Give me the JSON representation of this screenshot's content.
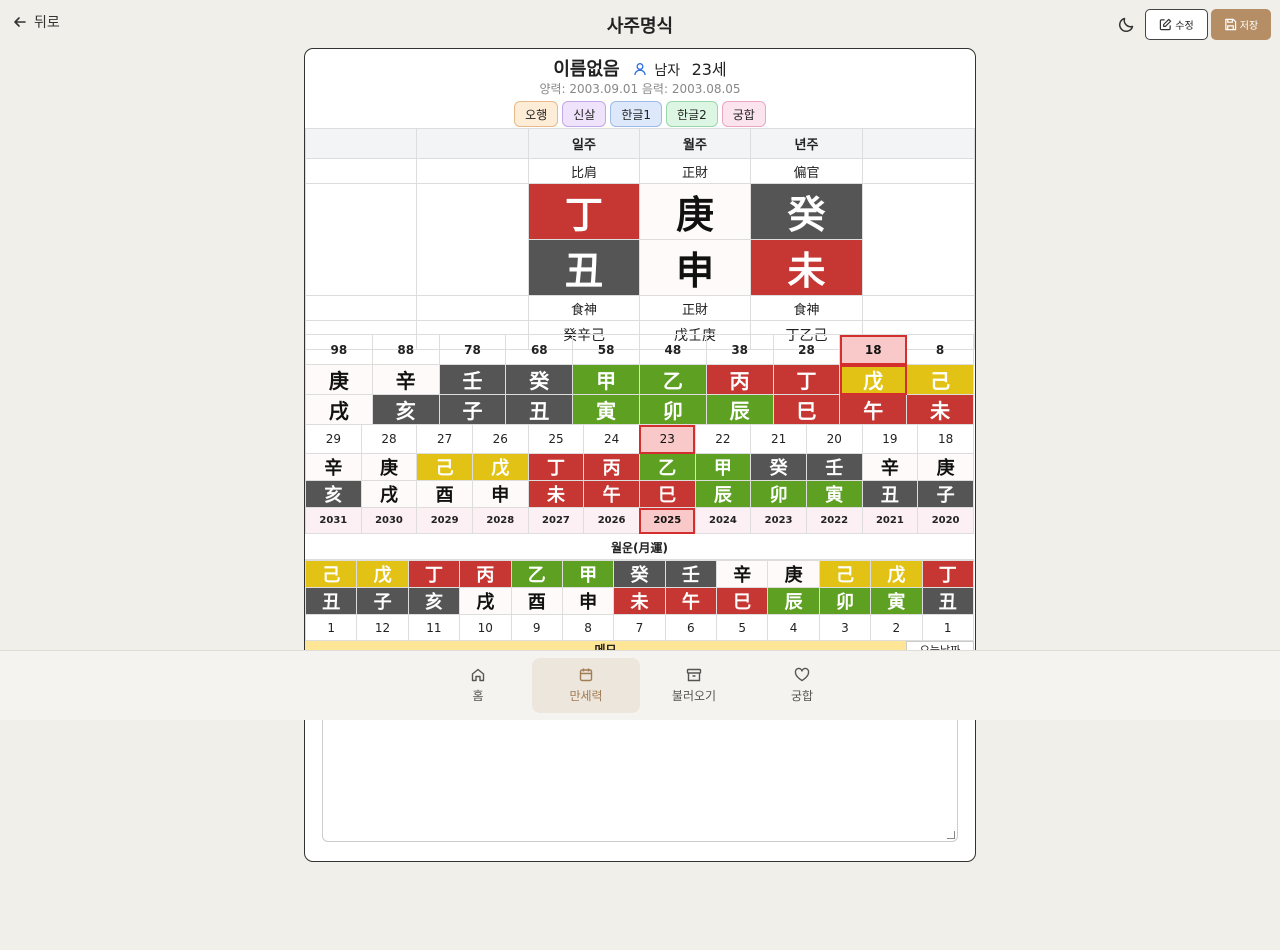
{
  "header": {
    "back_label": "뒤로",
    "title": "사주명식",
    "edit_label": "수정",
    "save_label": "저장"
  },
  "profile": {
    "name": "이름없음",
    "gender": "남자",
    "age": "23세",
    "dates": "양력: 2003.09.01 음력: 2003.08.05"
  },
  "tabs": [
    {
      "label": "오행",
      "bg": "#fdecd6",
      "border": "#e8b98a"
    },
    {
      "label": "신살",
      "bg": "#efe3fb",
      "border": "#c7a6ea"
    },
    {
      "label": "한글1",
      "bg": "#dde8fb",
      "border": "#a1bbe8"
    },
    {
      "label": "한글2",
      "bg": "#dcf6e3",
      "border": "#9ad7ab"
    },
    {
      "label": "궁합",
      "bg": "#fce4ee",
      "border": "#eaa5c3"
    }
  ],
  "pillars": {
    "headers": [
      "",
      "",
      "일주",
      "월주",
      "년주",
      ""
    ],
    "sipsin_top": [
      "",
      "",
      "比肩",
      "正財",
      "偏官",
      ""
    ],
    "stems": [
      "丁",
      "庚",
      "癸"
    ],
    "branches": [
      "丑",
      "申",
      "未"
    ],
    "sipsin_bottom": [
      "",
      "",
      "食神",
      "正財",
      "食神",
      ""
    ],
    "jijanggan": [
      "",
      "",
      "癸辛己",
      "戊壬庚",
      "丁乙己",
      ""
    ]
  },
  "daeun": {
    "ages": [
      "98",
      "88",
      "78",
      "68",
      "58",
      "48",
      "38",
      "28",
      "18",
      "8"
    ],
    "stems": [
      "庚",
      "辛",
      "壬",
      "癸",
      "甲",
      "乙",
      "丙",
      "丁",
      "戊",
      "己"
    ],
    "branches": [
      "戌",
      "亥",
      "子",
      "丑",
      "寅",
      "卯",
      "辰",
      "巳",
      "午",
      "未"
    ]
  },
  "yearly": {
    "ages": [
      "29",
      "28",
      "27",
      "26",
      "25",
      "24",
      "23",
      "22",
      "21",
      "20",
      "19",
      "18"
    ],
    "stems": [
      "辛",
      "庚",
      "己",
      "戊",
      "丁",
      "丙",
      "乙",
      "甲",
      "癸",
      "壬",
      "辛",
      "庚"
    ],
    "branches": [
      "亥",
      "戌",
      "酉",
      "申",
      "未",
      "午",
      "巳",
      "辰",
      "卯",
      "寅",
      "丑",
      "子"
    ],
    "years": [
      "2031",
      "2030",
      "2029",
      "2028",
      "2027",
      "2026",
      "2025",
      "2024",
      "2023",
      "2022",
      "2021",
      "2020"
    ]
  },
  "monthly": {
    "title": "월운(月運)",
    "stems": [
      "己",
      "戊",
      "丁",
      "丙",
      "乙",
      "甲",
      "癸",
      "壬",
      "辛",
      "庚",
      "己",
      "戊",
      "丁"
    ],
    "branches": [
      "丑",
      "子",
      "亥",
      "戌",
      "酉",
      "申",
      "未",
      "午",
      "巳",
      "辰",
      "卯",
      "寅",
      "丑"
    ],
    "months": [
      "1",
      "12",
      "11",
      "10",
      "9",
      "8",
      "7",
      "6",
      "5",
      "4",
      "3",
      "2",
      "1"
    ]
  },
  "memo": {
    "bar_label": "메모",
    "today_label": "오늘날짜"
  },
  "nav": [
    {
      "label": "홈",
      "icon": "home-icon"
    },
    {
      "label": "만세력",
      "icon": "calendar-icon"
    },
    {
      "label": "불러오기",
      "icon": "archive-icon"
    },
    {
      "label": "궁합",
      "icon": "heart-icon"
    }
  ],
  "colors": {
    "fire_red": "#c63733",
    "water_dark": "#555555",
    "wood_green": "#5ea122",
    "earth_yellow": "#e2c215",
    "metal_white": "#fffafa",
    "accent": "#b58e66",
    "highlight": "#d32f2f"
  }
}
